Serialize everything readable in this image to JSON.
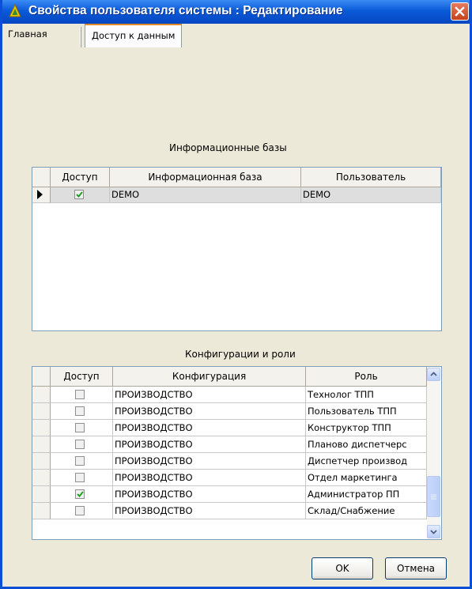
{
  "window": {
    "title": "Свойства пользователя системы : Редактирование",
    "accent": "#0A4FD6",
    "close_color": "#D24A20"
  },
  "tabs": [
    {
      "label": "Главная",
      "active": false
    },
    {
      "label": "Доступ к данным",
      "active": true
    }
  ],
  "infobases": {
    "title": "Информационные базы",
    "columns": [
      "Доступ",
      "Информационная база",
      "Пользователь"
    ],
    "rows": [
      {
        "access": true,
        "base": "DEMO",
        "user": "DEMO",
        "selected": true
      }
    ]
  },
  "configs": {
    "title": "Конфигурации и роли",
    "columns": [
      "Доступ",
      "Конфигурация",
      "Роль"
    ],
    "rows": [
      {
        "access": false,
        "config": "ПРОИЗВОДСТВО",
        "role": "Технолог ТПП"
      },
      {
        "access": false,
        "config": "ПРОИЗВОДСТВО",
        "role": "Пользователь ТПП"
      },
      {
        "access": false,
        "config": "ПРОИЗВОДСТВО",
        "role": "Конструктор ТПП"
      },
      {
        "access": false,
        "config": "ПРОИЗВОДСТВО",
        "role": "Планово диспетчерс"
      },
      {
        "access": false,
        "config": "ПРОИЗВОДСТВО",
        "role": "Диспетчер производ"
      },
      {
        "access": false,
        "config": "ПРОИЗВОДСТВО",
        "role": "Отдел маркетинга"
      },
      {
        "access": true,
        "config": "ПРОИЗВОДСТВО",
        "role": "Администратор ПП"
      },
      {
        "access": false,
        "config": "ПРОИЗВОДСТВО",
        "role": "Склад/Снабжение"
      }
    ]
  },
  "buttons": {
    "ok": "OK",
    "cancel": "Отмена"
  }
}
